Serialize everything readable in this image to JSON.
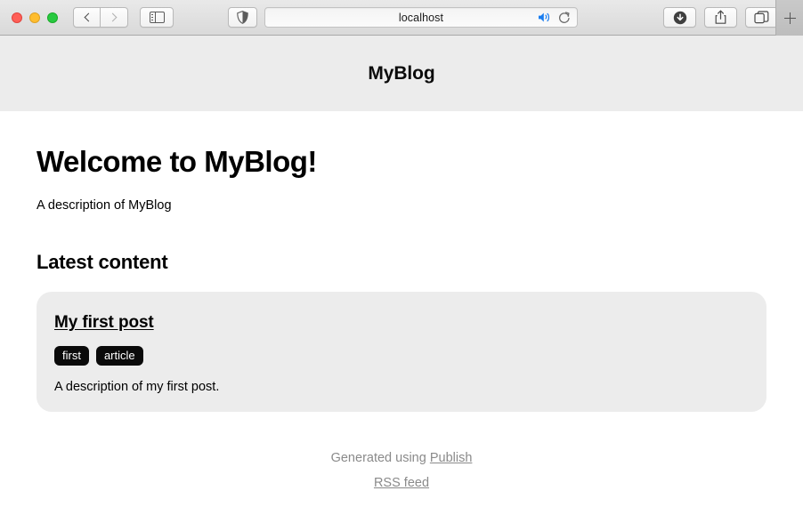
{
  "browser": {
    "traffic_lights": [
      "close",
      "minimize",
      "maximize"
    ],
    "back_label": "Back",
    "forward_label": "Forward",
    "sidebar_label": "Show sidebar",
    "shield_label": "Privacy Report",
    "url_value": "localhost",
    "url_placeholder": "Search or enter website name",
    "audio_label": "Mute tab audio",
    "reload_label": "Reload this page",
    "downloads_label": "Show downloads",
    "share_label": "Share",
    "tabs_label": "Show tab overview",
    "newtab_label": "New tab",
    "icons": {
      "shield": "shield-icon",
      "speaker": "speaker-icon",
      "reload": "reload-icon",
      "download": "download-icon",
      "share": "share-icon",
      "tabs": "tab-overview-icon",
      "sidebar": "sidebar-icon",
      "plus": "plus-icon"
    }
  },
  "site": {
    "title": "MyBlog"
  },
  "main": {
    "welcome_heading": "Welcome to MyBlog!",
    "description": "A description of MyBlog",
    "section_title": "Latest content",
    "posts": [
      {
        "title": "My first post",
        "tags": [
          "first",
          "article"
        ],
        "description": "A description of my first post."
      }
    ]
  },
  "footer": {
    "generated_prefix": "Generated using ",
    "generator_link": "Publish",
    "rss_link": "RSS feed"
  },
  "colors": {
    "header_bg": "#ececec",
    "card_bg": "#ececec",
    "tag_bg": "#0a0a0a",
    "footer_text": "#8a8a8a",
    "audio_accent": "#1a7df0"
  }
}
